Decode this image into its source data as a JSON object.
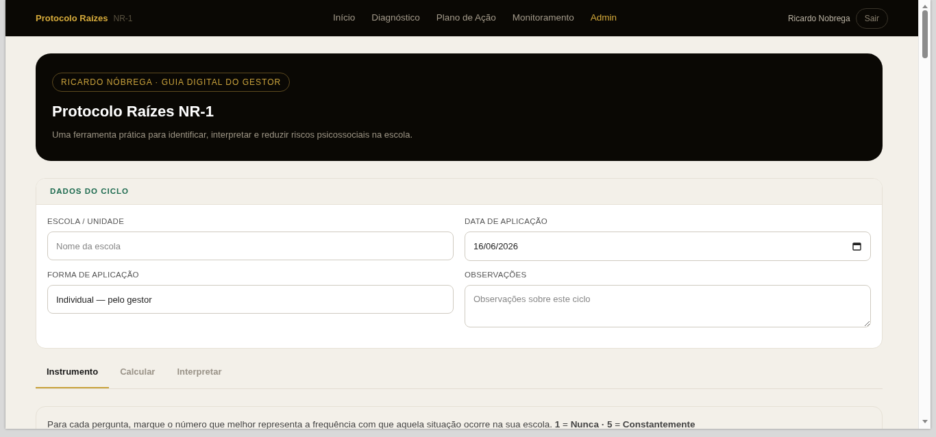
{
  "navbar": {
    "brand": "Protocolo Raízes",
    "brand_suffix": "NR-1",
    "links": [
      {
        "label": "Início",
        "selected": false
      },
      {
        "label": "Diagnóstico",
        "selected": false
      },
      {
        "label": "Plano de Ação",
        "selected": false
      },
      {
        "label": "Monitoramento",
        "selected": false
      },
      {
        "label": "Admin",
        "selected": true
      }
    ],
    "user": "Ricardo Nobrega",
    "logout": "Sair"
  },
  "hero": {
    "badge": "RICARDO NÓBREGA · GUIA DIGITAL DO GESTOR",
    "title": "Protocolo Raízes NR-1",
    "subtitle": "Uma ferramenta prática para identificar, interpretar e reduzir riscos psicossociais na escola."
  },
  "cycle_card": {
    "header": "DADOS DO CICLO",
    "fields": [
      {
        "label": "ESCOLA / UNIDADE",
        "kind": "text",
        "placeholder": "Nome da escola"
      },
      {
        "label": "DATA DE APLICAÇÃO",
        "kind": "date",
        "value": "16/06/2026"
      },
      {
        "label": "FORMA DE APLICAÇÃO",
        "kind": "select",
        "value": "Individual — pelo gestor"
      },
      {
        "label": "OBSERVAÇÕES",
        "kind": "textarea",
        "placeholder": "Observações sobre este ciclo"
      }
    ]
  },
  "tabs": [
    {
      "label": "Instrumento",
      "selected": true
    },
    {
      "label": "Calcular",
      "selected": false
    },
    {
      "label": "Interpretar",
      "selected": false
    }
  ],
  "instructions": "Para cada pergunta, marque o número que melhor representa a frequência com que aquela situação ocorre na sua escola. **1** = **Nunca · 5** = **Constantemente**"
}
